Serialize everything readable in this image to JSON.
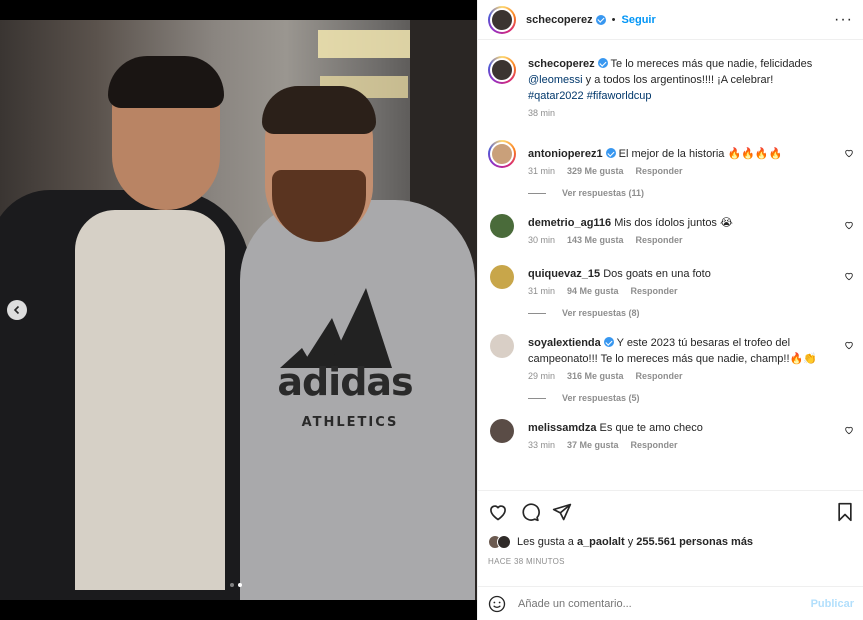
{
  "post": {
    "author": "schecoperez",
    "follow_label": "Seguir",
    "caption_author": "schecoperez",
    "caption_text": "Te lo mereces más que nadie, felicidades",
    "caption_mention": "@leomessi",
    "caption_text2": "y a todos los argentinos!!!! ¡A celebrar!",
    "caption_hashtag1": "#qatar2022",
    "caption_hashtag2": "#fifaworldcup",
    "caption_time": "38 min"
  },
  "media": {
    "shirt_brand": "adidas",
    "shirt_sub": "ATHLETICS",
    "slide_count": 2,
    "active_slide": 2
  },
  "comments": [
    {
      "user": "antonioperez1",
      "verified": true,
      "text": "El mejor de la historia 🔥🔥🔥🔥",
      "time": "31 min",
      "likes": "329 Me gusta",
      "reply": "Responder",
      "replies": "Ver respuestas (11)",
      "avatar_color": "#c9a07a"
    },
    {
      "user": "demetrio_ag116",
      "verified": false,
      "text": "Mis dos ídolos juntos 😭",
      "time": "30 min",
      "likes": "143 Me gusta",
      "reply": "Responder",
      "replies": "",
      "avatar_color": "#4a6b3a"
    },
    {
      "user": "quiquevaz_15",
      "verified": false,
      "text": "Dos goats en una foto",
      "time": "31 min",
      "likes": "94 Me gusta",
      "reply": "Responder",
      "replies": "Ver respuestas (8)",
      "avatar_color": "#c8a64a"
    },
    {
      "user": "soyalextienda",
      "verified": true,
      "text": "Y este 2023 tú besaras el trofeo del campeonato!!! Te lo mereces más que nadie, champ!!🔥👏",
      "time": "29 min",
      "likes": "316 Me gusta",
      "reply": "Responder",
      "replies": "Ver respuestas (5)",
      "avatar_color": "#d9cfc6"
    },
    {
      "user": "melissamdza",
      "verified": false,
      "text": "Es que te amo checo",
      "time": "33 min",
      "likes": "37 Me gusta",
      "reply": "Responder",
      "replies": "",
      "avatar_color": "#5a4c46"
    }
  ],
  "likes": {
    "prefix": "Les gusta a",
    "user": "a_paolalt",
    "middle": "y",
    "count": "255.561 personas más"
  },
  "timestamp": "HACE 38 MINUTOS",
  "add_comment": {
    "placeholder": "Añade un comentario...",
    "publish": "Publicar"
  },
  "colors": {
    "link_blue": "#0095f6",
    "tag_blue": "#00376b",
    "muted": "#8e8e8e"
  },
  "icons": [
    "carousel-prev-icon",
    "more-options-icon",
    "verified-icon",
    "heart-icon",
    "comment-icon",
    "share-icon",
    "bookmark-icon",
    "emoji-icon"
  ]
}
